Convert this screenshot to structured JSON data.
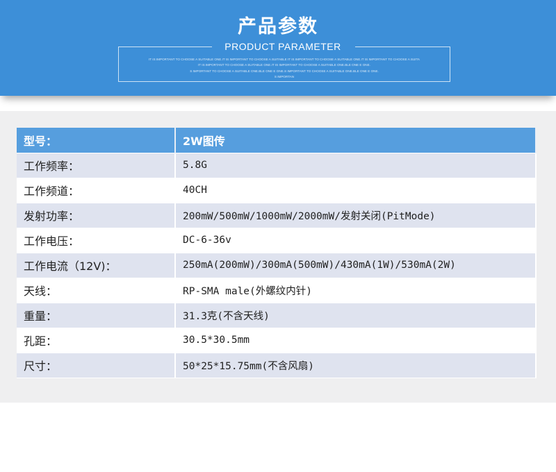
{
  "header": {
    "title": "产品参数",
    "subtitle": "PRODUCT PARAMETER",
    "fine_print": [
      "IT IS IMPORTANT TO CHOOSE A SUITABLE ONE.IT IS IMPORTANT TO CHOOSE A SUITABLE IT IS IMPORTANT TO CHOOSE A SUITABLE ONE.IT IS IMPORTANT TO CHOOSE A SUITA",
      "IT IS IMPORTANT TO CHOOSE A SUITABLE ONE.IT IS IMPORTANT TO CHOOSE A SUITABLE ONE.BLE ONE E ONE.",
      "S IMPORTANT TO CHOOSE A SUITABLE ONE.BLE ONE E ONE.S IMPORTANT TO CHOOSE A SUITABLE ONE.BLE ONE E ONE.",
      "S IMPORTAN"
    ]
  },
  "table": {
    "header": {
      "key": "型号：",
      "value": "2W图传"
    },
    "rows": [
      {
        "key": "工作频率：",
        "value": "5.8G"
      },
      {
        "key": "工作频道：",
        "value": "40CH"
      },
      {
        "key": "发射功率：",
        "value": "200mW/500mW/1000mW/2000mW/发射关闭(PitMode)"
      },
      {
        "key": "工作电压：",
        "value": "DC-6-36v"
      },
      {
        "key": "工作电流（12V)：",
        "value": "250mA(200mW)/300mA(500mW)/430mA(1W)/530mA(2W)"
      },
      {
        "key": "天线：",
        "value": "RP-SMA male(外螺纹内针)"
      },
      {
        "key": "重量：",
        "value": "31.3克(不含天线)"
      },
      {
        "key": "孔距：",
        "value": "30.5*30.5mm"
      },
      {
        "key": "尺寸：",
        "value": "50*25*15.75mm(不含风扇)"
      }
    ]
  }
}
